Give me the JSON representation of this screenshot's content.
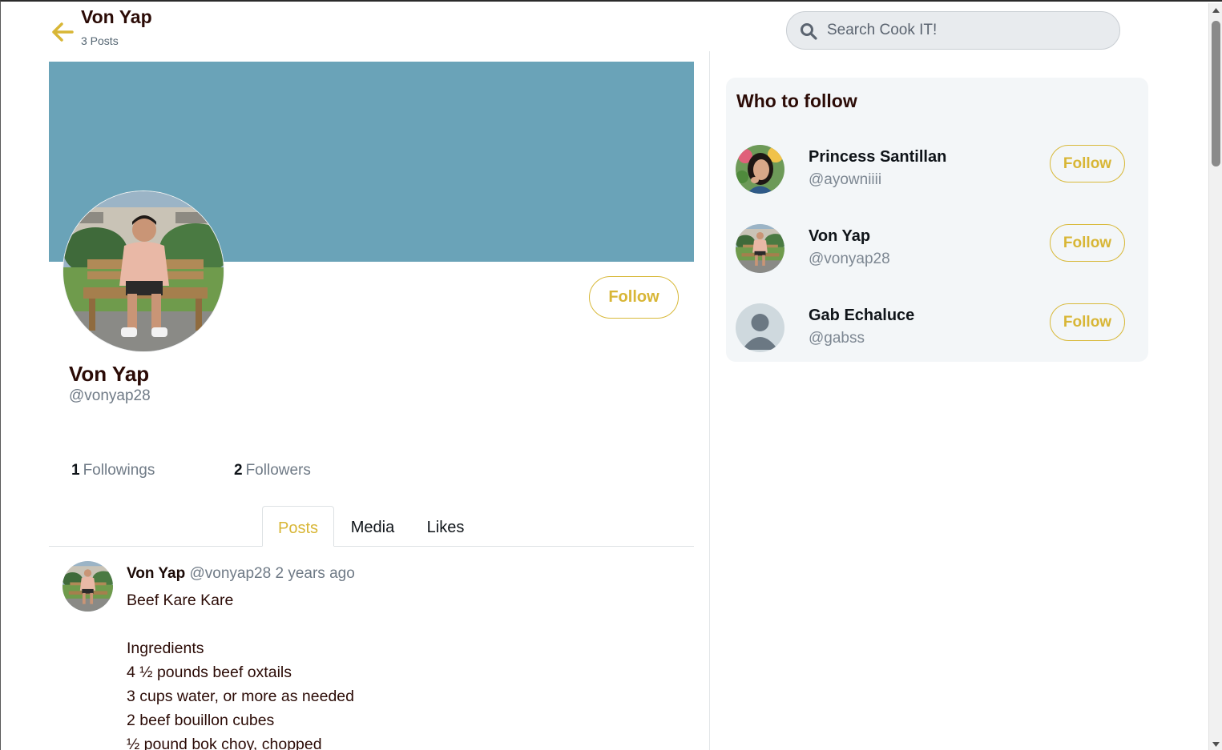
{
  "header": {
    "title": "Von Yap",
    "post_count": "3 Posts"
  },
  "search": {
    "placeholder": "Search Cook IT!"
  },
  "colors": {
    "accent": "#d8b636",
    "banner": "#6aa3b8",
    "heading": "#2b0b06"
  },
  "profile": {
    "name": "Von Yap",
    "handle": "@vonyap28",
    "follow_label": "Follow",
    "followings_count": "1",
    "followings_label": "Followings",
    "followers_count": "2",
    "followers_label": "Followers"
  },
  "tabs": [
    {
      "label": "Posts",
      "active": true
    },
    {
      "label": "Media",
      "active": false
    },
    {
      "label": "Likes",
      "active": false
    }
  ],
  "post": {
    "author": "Von Yap",
    "handle": "@vonyap28",
    "time": "2 years ago",
    "lines": [
      "Beef Kare Kare",
      "",
      "Ingredients",
      "4 ½ pounds beef oxtails",
      "3 cups water, or more as needed",
      "2 beef bouillon cubes",
      "½ pound bok choy, chopped"
    ]
  },
  "who_to_follow": {
    "title": "Who to follow",
    "users": [
      {
        "name": "Princess Santillan",
        "handle": "@ayowniiii",
        "button": "Follow"
      },
      {
        "name": "Von Yap",
        "handle": "@vonyap28",
        "button": "Follow"
      },
      {
        "name": "Gab Echaluce",
        "handle": "@gabss",
        "button": "Follow"
      }
    ]
  },
  "icons": {
    "back": "arrow-left-icon",
    "search": "search-icon"
  }
}
